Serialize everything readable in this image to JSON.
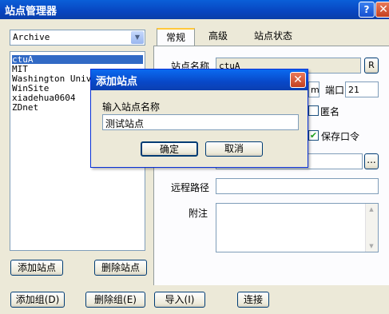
{
  "window": {
    "title": "站点管理器",
    "help": "?",
    "close": "✕"
  },
  "archive_select": {
    "value": "Archive",
    "arrow": "▼"
  },
  "sites": [
    "ctuA",
    "MIT",
    "Washington Univer",
    "WinSite",
    "xiadehua0604",
    "ZDnet"
  ],
  "tabs": [
    "常规",
    "高级",
    "站点状态"
  ],
  "general": {
    "site_name_label": "站点名称",
    "site_name_value": "ctuA",
    "rename_button": "R",
    "host_suffix": "m",
    "port_label": "端口",
    "port_value": "21",
    "anonymous_label": "匿名",
    "save_password_label": "保存口令",
    "browse_button": "...",
    "remote_path_label": "远程路径",
    "notes_label": "附注"
  },
  "buttons": {
    "add_site": "添加站点",
    "delete_site": "删除站点",
    "add_group": "添加组(D)",
    "delete_group": "删除组(E)",
    "import": "导入(I)",
    "connect": "连接"
  },
  "dialog": {
    "title": "添加站点",
    "close": "✕",
    "prompt": "输入站点名称",
    "input_value": "测试站点",
    "ok": "确定",
    "cancel": "取消"
  }
}
